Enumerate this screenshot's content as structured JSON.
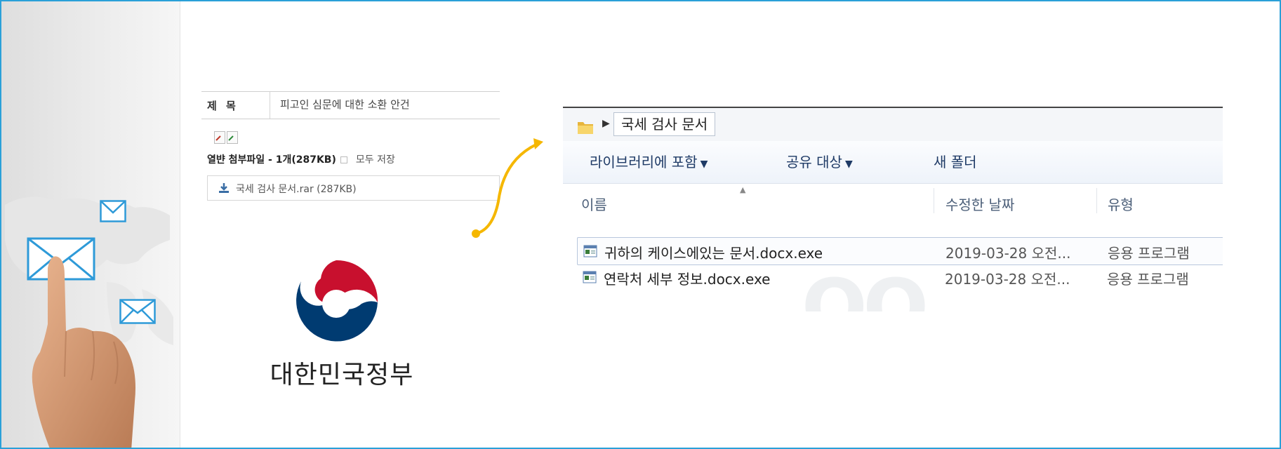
{
  "email": {
    "subject_label": "제 목",
    "subject_value": "피고인 심문에 대한 소환 안건",
    "attachment_summary": "열뱐 첨부파일 - 1개(287KB)",
    "save_all": "모두 저장",
    "attachment_file": "국세 검사 문서.rar (287KB)"
  },
  "government": {
    "name": "대한민국정부"
  },
  "explorer": {
    "breadcrumb": "국세 검사 문서",
    "toolbar": {
      "include_library": "라이브러리에 포함",
      "share_with": "공유 대상",
      "new_folder": "새 폴더"
    },
    "columns": {
      "name": "이름",
      "date_modified": "수정한 날짜",
      "type": "유형"
    },
    "files": [
      {
        "name": "귀하의 케이스에있는 문서.docx.exe",
        "date": "2019-03-28 오전...",
        "type": "응용 프로그램",
        "selected": true
      },
      {
        "name": "연락처 세부 정보.docx.exe",
        "date": "2019-03-28 오전...",
        "type": "응용 프로그램",
        "selected": false
      }
    ]
  },
  "colors": {
    "frame_border": "#2aa0d8",
    "arrow": "#f5b700",
    "logo_red": "#c8102e",
    "logo_blue": "#003b71"
  },
  "icons": [
    "envelope-icon",
    "folder-icon",
    "download-icon",
    "exe-file-icon",
    "government-logo"
  ]
}
